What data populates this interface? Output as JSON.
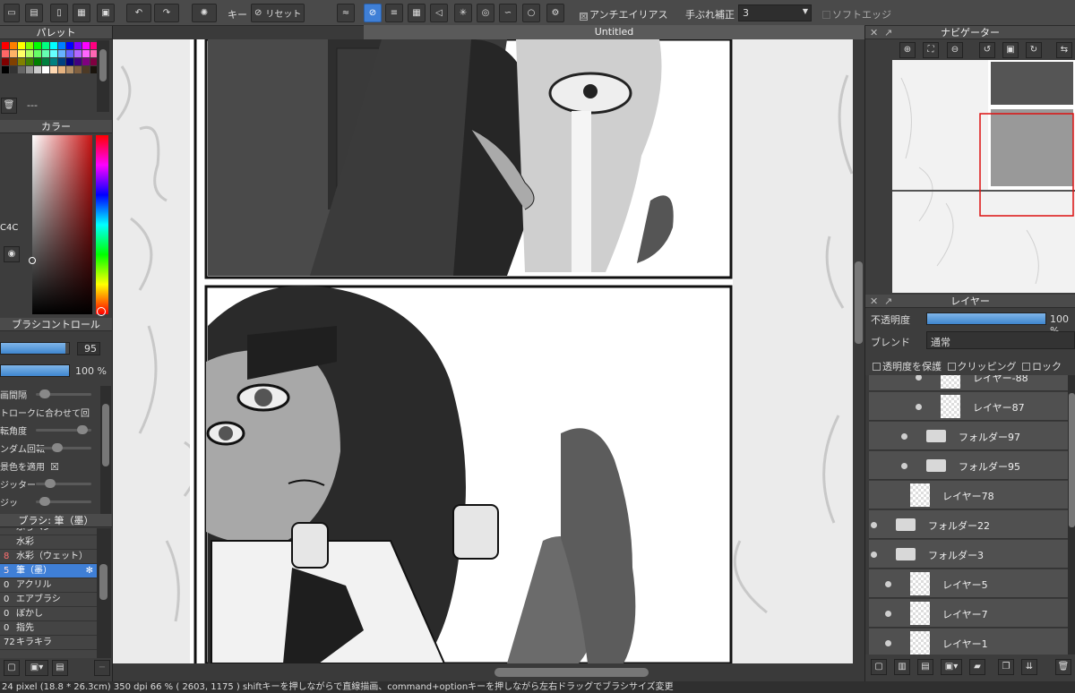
{
  "toolbar": {
    "key_label": "キー",
    "reset_label": "リセット",
    "antialias_label": "アンチエイリアス",
    "antialias_checked": "☒",
    "stabilizer_label": "手ぶれ補正",
    "stabilizer_value": "3",
    "soft_edge_label": "ソフトエッジ"
  },
  "document": {
    "title": "Untitled"
  },
  "palette": {
    "title": "パレット",
    "selected_label": "---",
    "colors": [
      "#ff0000",
      "#ff8000",
      "#ffff00",
      "#80ff00",
      "#00ff00",
      "#00ff80",
      "#00ffff",
      "#0080ff",
      "#0000ff",
      "#8000ff",
      "#ff00ff",
      "#ff0080",
      "#ff6666",
      "#ffb266",
      "#ffff66",
      "#b2ff66",
      "#66ff66",
      "#66ffb2",
      "#66ffff",
      "#66b2ff",
      "#6666ff",
      "#b266ff",
      "#ff66ff",
      "#ff66b2",
      "#800000",
      "#804000",
      "#808000",
      "#408000",
      "#008000",
      "#008040",
      "#008080",
      "#004080",
      "#000080",
      "#400080",
      "#800080",
      "#800040",
      "#000000",
      "#333333",
      "#666666",
      "#999999",
      "#cccccc",
      "#ffffff",
      "#ffd9b3",
      "#e6b380",
      "#b38f66",
      "#806040",
      "#4d3a26",
      "#1a140d"
    ]
  },
  "color_panel": {
    "title": "カラー",
    "hex_fragment": "C4C",
    "base_color": "#c81414"
  },
  "brush_control": {
    "title": "ブラシコントロール",
    "size_value": "95",
    "opacity_value": "100 %",
    "size_level": 0.95,
    "opacity_level": 1.0,
    "options": [
      {
        "label": "画間隔"
      },
      {
        "label": "トロークに合わせて回"
      },
      {
        "label": "転角度"
      },
      {
        "label": "ンダム回転"
      },
      {
        "label": "景色を適用",
        "mark": "☒"
      },
      {
        "label": "ジッター"
      },
      {
        "label": "ジッ"
      }
    ]
  },
  "brush_list": {
    "title": "ブラシ: 筆（墨）",
    "items": [
      {
        "num": "",
        "label": "ふちペン"
      },
      {
        "num": "",
        "label": "水彩"
      },
      {
        "num": "8",
        "label": "水彩（ウェット）"
      },
      {
        "num": "5",
        "label": "筆（墨）",
        "selected": true
      },
      {
        "num": "0",
        "label": "アクリル"
      },
      {
        "num": "0",
        "label": "エアブラシ"
      },
      {
        "num": "0",
        "label": "ぼかし"
      },
      {
        "num": "0",
        "label": "指先"
      },
      {
        "num": "72",
        "label": "キラキラ"
      }
    ]
  },
  "navigator": {
    "title": "ナビゲーター"
  },
  "layers_panel": {
    "title": "レイヤー",
    "opacity_label": "不透明度",
    "opacity_value": "100 %",
    "opacity_level": 1.0,
    "blend_label": "ブレンド",
    "blend_value": "通常",
    "protect_alpha_label": "透明度を保護",
    "clipping_label": "クリッピング",
    "lock_label": "ロック",
    "layers": [
      {
        "name": "レイヤー-88",
        "type": "layer",
        "visible": true
      },
      {
        "name": "レイヤー87",
        "type": "layer",
        "visible": true
      },
      {
        "name": "フォルダー97",
        "type": "folder",
        "visible": true
      },
      {
        "name": "フォルダー95",
        "type": "folder",
        "visible": true
      },
      {
        "name": "レイヤー78",
        "type": "layer",
        "visible": false
      },
      {
        "name": "フォルダー22",
        "type": "folder",
        "visible": true
      },
      {
        "name": "フォルダー3",
        "type": "folder",
        "visible": true,
        "open": true
      },
      {
        "name": "レイヤー5",
        "type": "layer",
        "visible": true
      },
      {
        "name": "レイヤー7",
        "type": "layer",
        "visible": true
      },
      {
        "name": "レイヤー1",
        "type": "layer",
        "visible": true
      }
    ]
  },
  "status": {
    "text": "24 pixel  (18.8 * 26.3cm)  350 dpi   66 %  ( 2603, 1175 )  shiftキーを押しながらで直線描画、command+optionキーを押しながら左右ドラッグでブラシサイズ変更"
  }
}
